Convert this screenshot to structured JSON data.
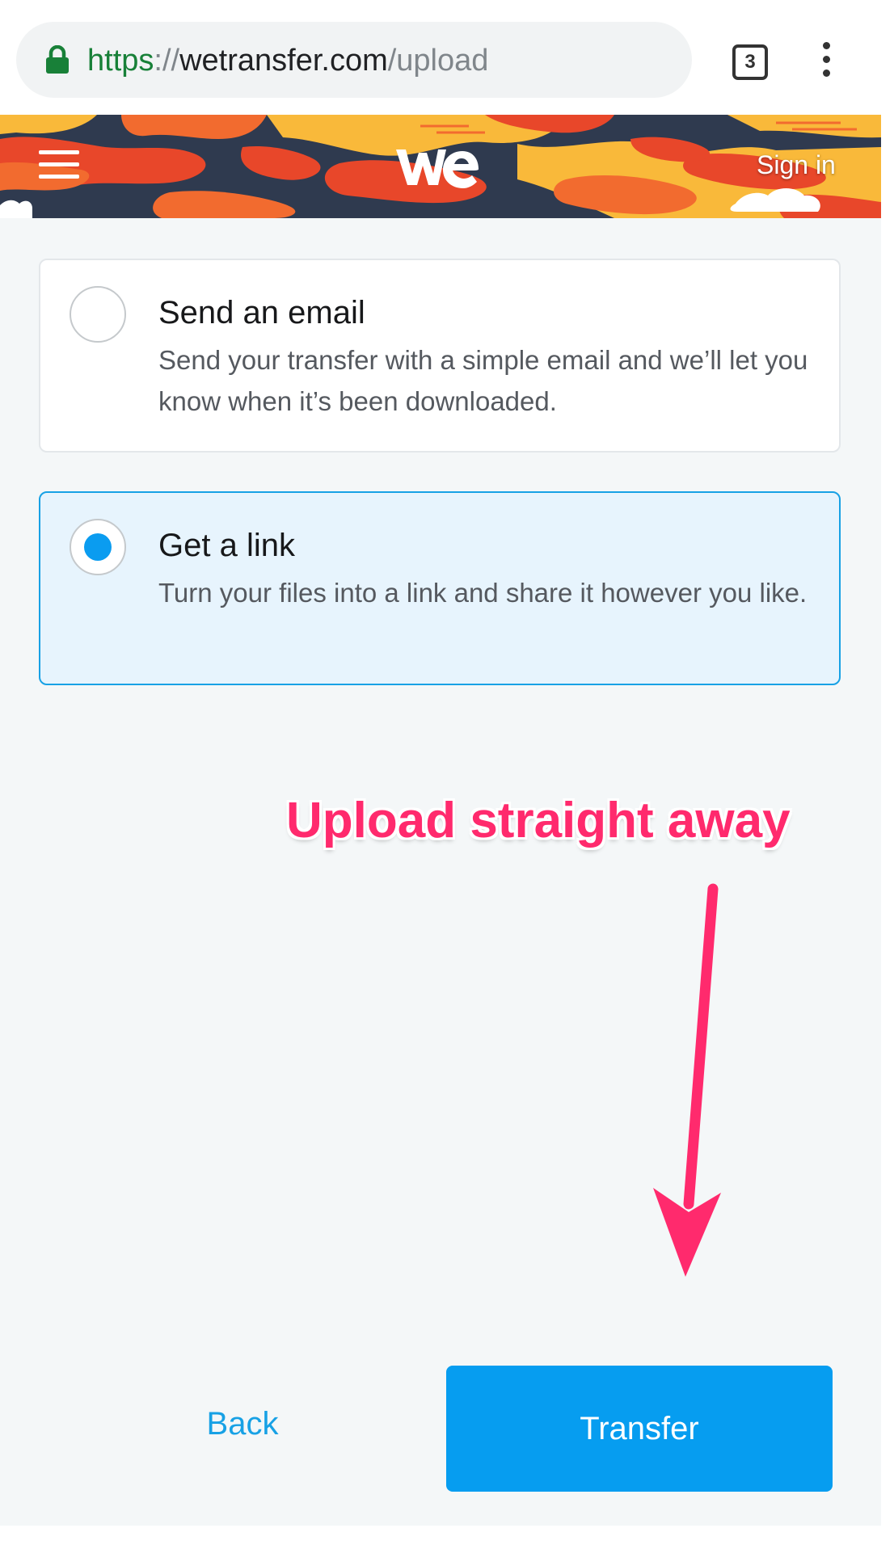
{
  "browser": {
    "url": {
      "scheme": "https",
      "separator": "://",
      "host": "wetransfer.com",
      "path": "/upload"
    },
    "tab_count": "3",
    "lock_icon": "lock-icon",
    "menu_icon": "kebab-menu-icon"
  },
  "header": {
    "menu_icon": "hamburger-icon",
    "logo": "we",
    "signin_label": "Sign in"
  },
  "options": [
    {
      "title": "Send an email",
      "description": "Send your transfer with a simple email and we’ll let you know when it’s been downloaded.",
      "selected": false
    },
    {
      "title": "Get a link",
      "description": "Turn your files into a link and share it however you like.",
      "selected": true
    }
  ],
  "annotation": {
    "text": "Upload straight away",
    "color": "#ff2a6d"
  },
  "footer": {
    "back_label": "Back",
    "transfer_label": "Transfer"
  },
  "colors": {
    "accent": "#069df0",
    "selected_card_bg": "#e7f4fd",
    "url_secure_green": "#188038"
  }
}
